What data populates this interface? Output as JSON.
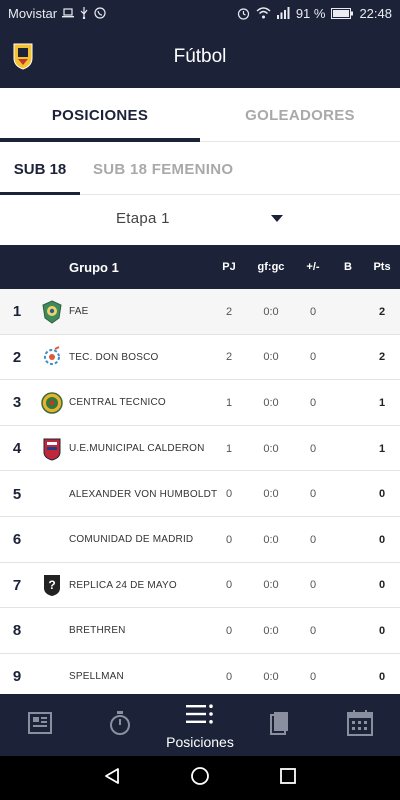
{
  "status_bar": {
    "carrier": "Movistar",
    "battery": "91 %",
    "time": "22:48"
  },
  "app_bar": {
    "title": "Fútbol",
    "logo_icon": "club-crest-icon"
  },
  "main_tabs": [
    {
      "label": "POSICIONES",
      "active": true
    },
    {
      "label": "GOLEADORES",
      "active": false
    }
  ],
  "sub_tabs": [
    {
      "label": "SUB 18",
      "active": true
    },
    {
      "label": "SUB 18 FEMENINO",
      "active": false
    }
  ],
  "stage": {
    "selected": "Etapa 1"
  },
  "table": {
    "group": "Grupo 1",
    "columns": {
      "pj": "PJ",
      "gf_gc": "gf:gc",
      "diff": "+/-",
      "b": "B",
      "pts": "Pts"
    },
    "rows": [
      {
        "pos": "1",
        "team": "FAE",
        "pj": "2",
        "gf_gc": "0:0",
        "diff": "0",
        "b": "",
        "pts": "2",
        "badge": "fae-crest-icon"
      },
      {
        "pos": "2",
        "team": "TEC. DON BOSCO",
        "pj": "2",
        "gf_gc": "0:0",
        "diff": "0",
        "b": "",
        "pts": "2",
        "badge": "don-bosco-crest-icon"
      },
      {
        "pos": "3",
        "team": "CENTRAL TECNICO",
        "pj": "1",
        "gf_gc": "0:0",
        "diff": "0",
        "b": "",
        "pts": "1",
        "badge": "central-tecnico-crest-icon"
      },
      {
        "pos": "4",
        "team": "U.E.MUNICIPAL CALDERON",
        "pj": "1",
        "gf_gc": "0:0",
        "diff": "0",
        "b": "",
        "pts": "1",
        "badge": "calderon-crest-icon"
      },
      {
        "pos": "5",
        "team": "ALEXANDER VON HUMBOLDT",
        "pj": "0",
        "gf_gc": "0:0",
        "diff": "0",
        "b": "",
        "pts": "0",
        "badge": ""
      },
      {
        "pos": "6",
        "team": "COMUNIDAD DE MADRID",
        "pj": "0",
        "gf_gc": "0:0",
        "diff": "0",
        "b": "",
        "pts": "0",
        "badge": ""
      },
      {
        "pos": "7",
        "team": "REPLICA 24 DE MAYO",
        "pj": "0",
        "gf_gc": "0:0",
        "diff": "0",
        "b": "",
        "pts": "0",
        "badge": "unknown-crest-icon"
      },
      {
        "pos": "8",
        "team": "BRETHREN",
        "pj": "0",
        "gf_gc": "0:0",
        "diff": "0",
        "b": "",
        "pts": "0",
        "badge": ""
      },
      {
        "pos": "9",
        "team": "SPELLMAN",
        "pj": "0",
        "gf_gc": "0:0",
        "diff": "0",
        "b": "",
        "pts": "0",
        "badge": ""
      }
    ]
  },
  "bottom_nav": [
    {
      "icon": "news-icon",
      "label": "",
      "active": false
    },
    {
      "icon": "stopwatch-icon",
      "label": "",
      "active": false
    },
    {
      "icon": "standings-list-icon",
      "label": "Posiciones",
      "active": true
    },
    {
      "icon": "cards-icon",
      "label": "",
      "active": false
    },
    {
      "icon": "calendar-icon",
      "label": "",
      "active": false
    }
  ],
  "colors": {
    "primary": "#1c2338",
    "inactive_text": "#a9a9a9",
    "nav_inactive_icon": "#8a8fa0"
  }
}
